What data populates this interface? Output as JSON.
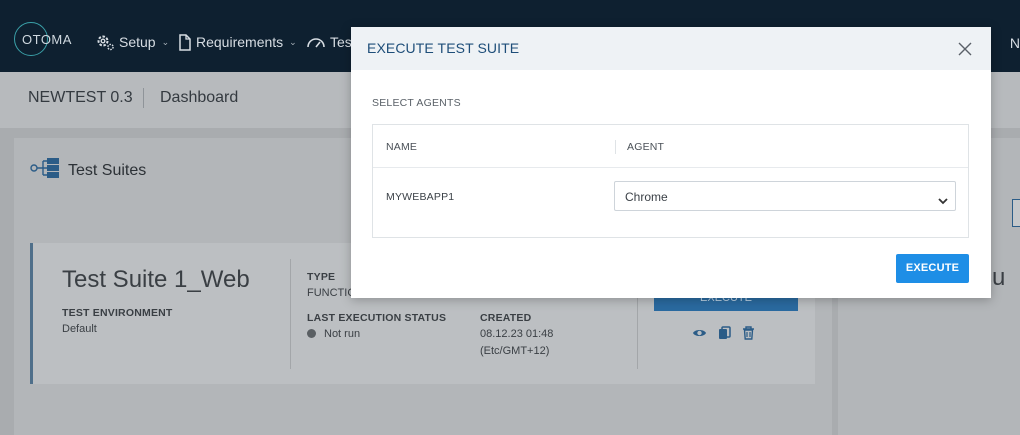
{
  "nav": {
    "logo": "OTOMA",
    "items": [
      {
        "label": "Setup",
        "icon": "gear-icon"
      },
      {
        "label": "Requirements",
        "icon": "document-icon"
      },
      {
        "label": "Tes",
        "icon": "gauge-icon"
      }
    ],
    "right_partial": "N"
  },
  "subheader": {
    "project": "NEWTEST 0.3",
    "page": "Dashboard"
  },
  "test_suites": {
    "header": "Test Suites",
    "card": {
      "title": "Test Suite 1_Web",
      "env_label": "TEST ENVIRONMENT",
      "env_value": "Default",
      "type_label": "TYPE",
      "type_value": "FUNCTIC",
      "last_exec_label": "LAST EXECUTION STATUS",
      "last_exec_value": "Not run",
      "created_label": "CREATED",
      "created_date": "08.12.23 01:48",
      "created_tz": "(Etc/GMT+12)",
      "execute_label": "EXECUTE"
    },
    "right_partial_text": "su"
  },
  "modal": {
    "title": "EXECUTE TEST SUITE",
    "section_label": "SELECT AGENTS",
    "columns": [
      "NAME",
      "AGENT"
    ],
    "rows": [
      {
        "name": "MYWEBAPP1",
        "agent": "Chrome"
      }
    ],
    "execute_label": "EXECUTE"
  },
  "colors": {
    "primary": "#1e8ee6",
    "nav_bg": "#0e2030",
    "title": "#1e4e79"
  }
}
